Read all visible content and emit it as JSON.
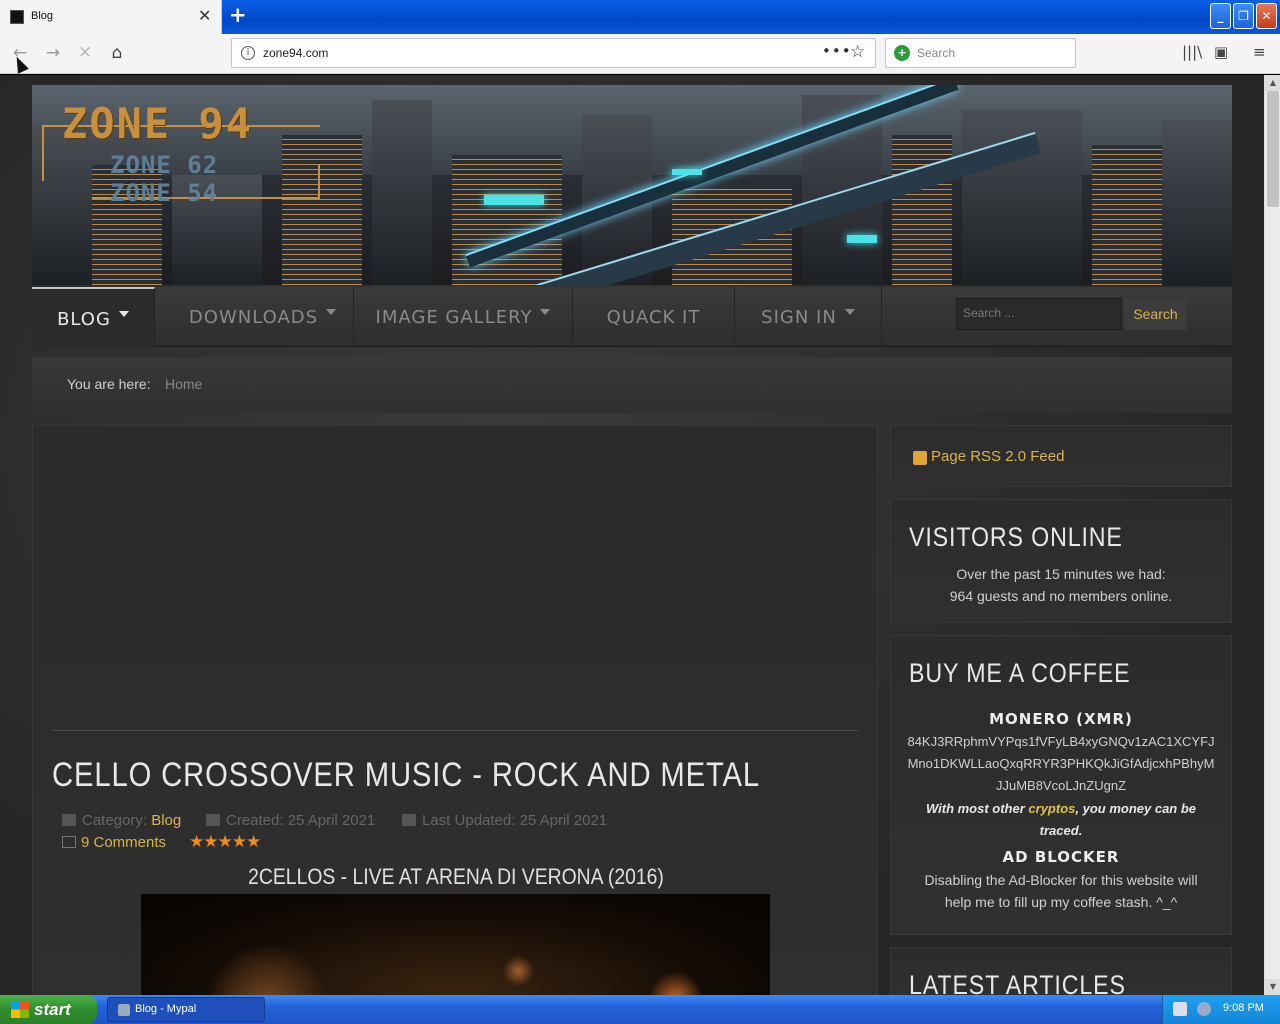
{
  "browser": {
    "tab_title": "Blog",
    "url": "zone94.com",
    "search_placeholder": "Search",
    "tab_close": "✕",
    "new_tab": "+",
    "url_more": "•••",
    "url_bookmark": "☆"
  },
  "window_controls": {
    "minimize": "_",
    "maximize": "❐",
    "close": "✕"
  },
  "nav_icons": [
    "back-icon",
    "forward-icon",
    "stop-icon",
    "home-icon",
    "library-icon",
    "sidebar-icon",
    "menu-icon"
  ],
  "site": {
    "logo_main": "ZONE 94",
    "logo_sub1": "ZONE 62",
    "logo_sub2": "ZONE 54",
    "menu": [
      {
        "label": "BLOG",
        "active": true,
        "dropdown": true
      },
      {
        "label": "DOWNLOADS",
        "active": false,
        "dropdown": true
      },
      {
        "label": "IMAGE GALLERY",
        "active": false,
        "dropdown": true
      },
      {
        "label": "QUACK IT",
        "active": false,
        "dropdown": false
      },
      {
        "label": "SIGN IN",
        "active": false,
        "dropdown": true
      }
    ],
    "search_placeholder": "Search ...",
    "search_button": "Search",
    "breadcrumb_label": "You are here:",
    "breadcrumb_home": "Home"
  },
  "article": {
    "title": "CELLO CROSSOVER MUSIC - ROCK AND METAL",
    "category_label": "Category:",
    "category": "Blog",
    "created": "Created: 25 April 2021",
    "updated": "Last Updated: 25 April 2021",
    "comments": "9 Comments",
    "rating": 5,
    "stars": "★★★★★",
    "video_title": "2CELLOS - LIVE AT ARENA DI VERONA (2016)"
  },
  "sidebar": {
    "rss": "Page RSS 2.0 Feed",
    "visitors_title": "VISITORS ONLINE",
    "visitors_line1": "Over the past 15 minutes we had:",
    "visitors_line2": "964 guests and no members online.",
    "coffee_title": "BUY ME A COFFEE",
    "monero_title": "MONERO (XMR)",
    "wallet": "84KJ3RRphmVYPqs1fVFyLB4xyGNQv1zAC1XCYFJMno1DKWLLaoQxqRRYR3PHKQkJiGfAdjcxhPBhyMJJuMB8VcoLJnZUgnZ",
    "note_pre": "With most other ",
    "note_hl": "cryptos",
    "note_post": ", you money can be traced.",
    "adblock_title": "AD BLOCKER",
    "adblock_text": "Disabling the Ad-Blocker for this website will help me to fill up my coffee stash. ^_^",
    "latest_title": "LATEST ARTICLES"
  },
  "taskbar": {
    "start": "start",
    "task": "Blog - Mypal",
    "clock": "9:08 PM"
  },
  "colors": {
    "accent": "#d9b44a",
    "star": "#f08a1c",
    "page_bg": "#2e2e2e",
    "logo": "#c88f3c"
  }
}
